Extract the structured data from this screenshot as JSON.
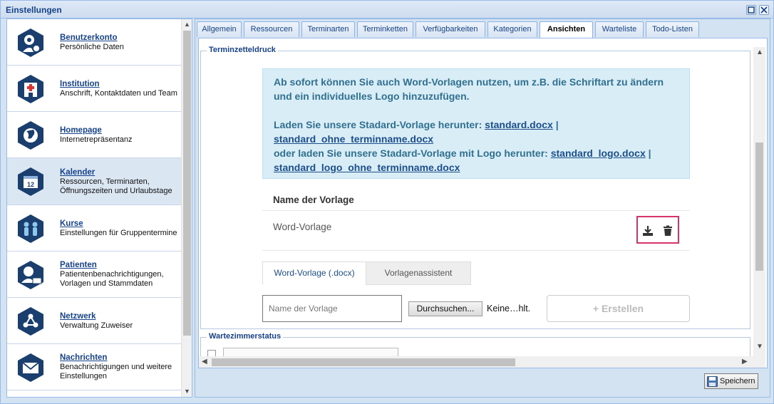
{
  "window": {
    "title": "Einstellungen"
  },
  "nav": {
    "items": [
      {
        "title": "Benutzerkonto",
        "desc": "Persönliche Daten",
        "icon": "user-settings-icon"
      },
      {
        "title": "Institution",
        "desc": "Anschrift, Kontaktdaten und Team",
        "icon": "hospital-icon"
      },
      {
        "title": "Homepage",
        "desc": "Internetrepräsentanz",
        "icon": "globe-icon"
      },
      {
        "title": "Kalender",
        "desc": "Ressourcen, Terminarten, Öffnungszeiten und Urlaubstage",
        "icon": "calendar-icon",
        "calendar_day": "12"
      },
      {
        "title": "Kurse",
        "desc": "Einstellungen für Gruppentermine",
        "icon": "group-icon"
      },
      {
        "title": "Patienten",
        "desc": "Patientenbenachrichtigungen, Vorlagen und Stammdaten",
        "icon": "patient-icon"
      },
      {
        "title": "Netzwerk",
        "desc": "Verwaltung Zuweiser",
        "icon": "network-icon"
      },
      {
        "title": "Nachrichten",
        "desc": "Benachrichtigungen und weitere Einstellungen",
        "icon": "envelope-icon"
      }
    ]
  },
  "tabs": [
    "Allgemein",
    "Ressourcen",
    "Terminarten",
    "Terminketten",
    "Verfügbarkeiten",
    "Kategorien",
    "Ansichten",
    "Warteliste",
    "Todo-Listen"
  ],
  "active_tab": "Ansichten",
  "section": {
    "legend": "Terminzetteldruck",
    "info": {
      "line1": "Ab sofort können Sie auch Word-Vorlagen nutzen, um z.B. die Schriftart zu ändern und ein individuelles Logo hinzuzufügen.",
      "line2_prefix": "Laden Sie unsere Stadard-Vorlage herunter: ",
      "link1": "standard.docx",
      "sep": " |",
      "link2": "standard_ohne_terminname.docx",
      "line3_prefix": "oder laden Sie unsere Stadard-Vorlage mit Logo herunter: ",
      "link3": "standard_logo.docx",
      "link4": "standard_logo_ohne_terminname.docx"
    },
    "table_header": "Name der Vorlage",
    "template_name": "Word-Vorlage",
    "subtabs": [
      "Word-Vorlage (.docx)",
      "Vorlagenassistent"
    ],
    "name_placeholder": "Name der Vorlage",
    "browse_label": "Durchsuchen...",
    "no_file_label": "Keine…hlt.",
    "create_label": "+ Erstellen"
  },
  "section2": {
    "legend": "Wartezimmerstatus"
  },
  "save_label": "Speichern",
  "colors": {
    "accent": "#15428b",
    "highlight": "#d6336c",
    "info_bg": "#d9edf7"
  }
}
